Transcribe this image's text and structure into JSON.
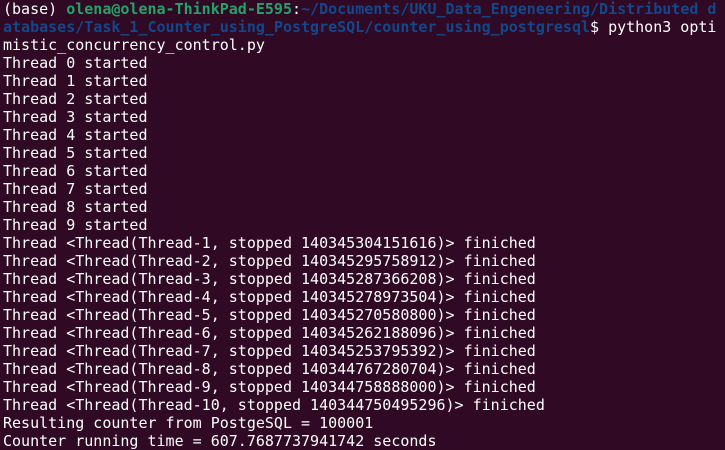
{
  "prompt": {
    "env": "(base) ",
    "user_host": "olena@olena-ThinkPad-E595",
    "colon": ":",
    "path": "~/Documents/UKU_Data_Engeneering/Distributed databases/Task_1_Counter_using_PostgreSQL/counter_using_postgresql",
    "symbol": "$ ",
    "command": "python3 optimistic_concurrency_control.py"
  },
  "output": [
    "Thread 0 started",
    "Thread 1 started",
    "Thread 2 started",
    "Thread 3 started",
    "Thread 4 started",
    "Thread 5 started",
    "Thread 6 started",
    "Thread 7 started",
    "Thread 8 started",
    "Thread 9 started",
    "Thread <Thread(Thread-1, stopped 140345304151616)> finiched",
    "Thread <Thread(Thread-2, stopped 140345295758912)> finiched",
    "Thread <Thread(Thread-3, stopped 140345287366208)> finiched",
    "Thread <Thread(Thread-4, stopped 140345278973504)> finiched",
    "Thread <Thread(Thread-5, stopped 140345270580800)> finiched",
    "Thread <Thread(Thread-6, stopped 140345262188096)> finiched",
    "Thread <Thread(Thread-7, stopped 140345253795392)> finiched",
    "Thread <Thread(Thread-8, stopped 140344767280704)> finiched",
    "Thread <Thread(Thread-9, stopped 140344758888000)> finiched",
    "Thread <Thread(Thread-10, stopped 140344750495296)> finiched",
    "Resulting counter from PostgeSQL = 100001",
    "Counter running time = 607.7687737941742 seconds"
  ]
}
